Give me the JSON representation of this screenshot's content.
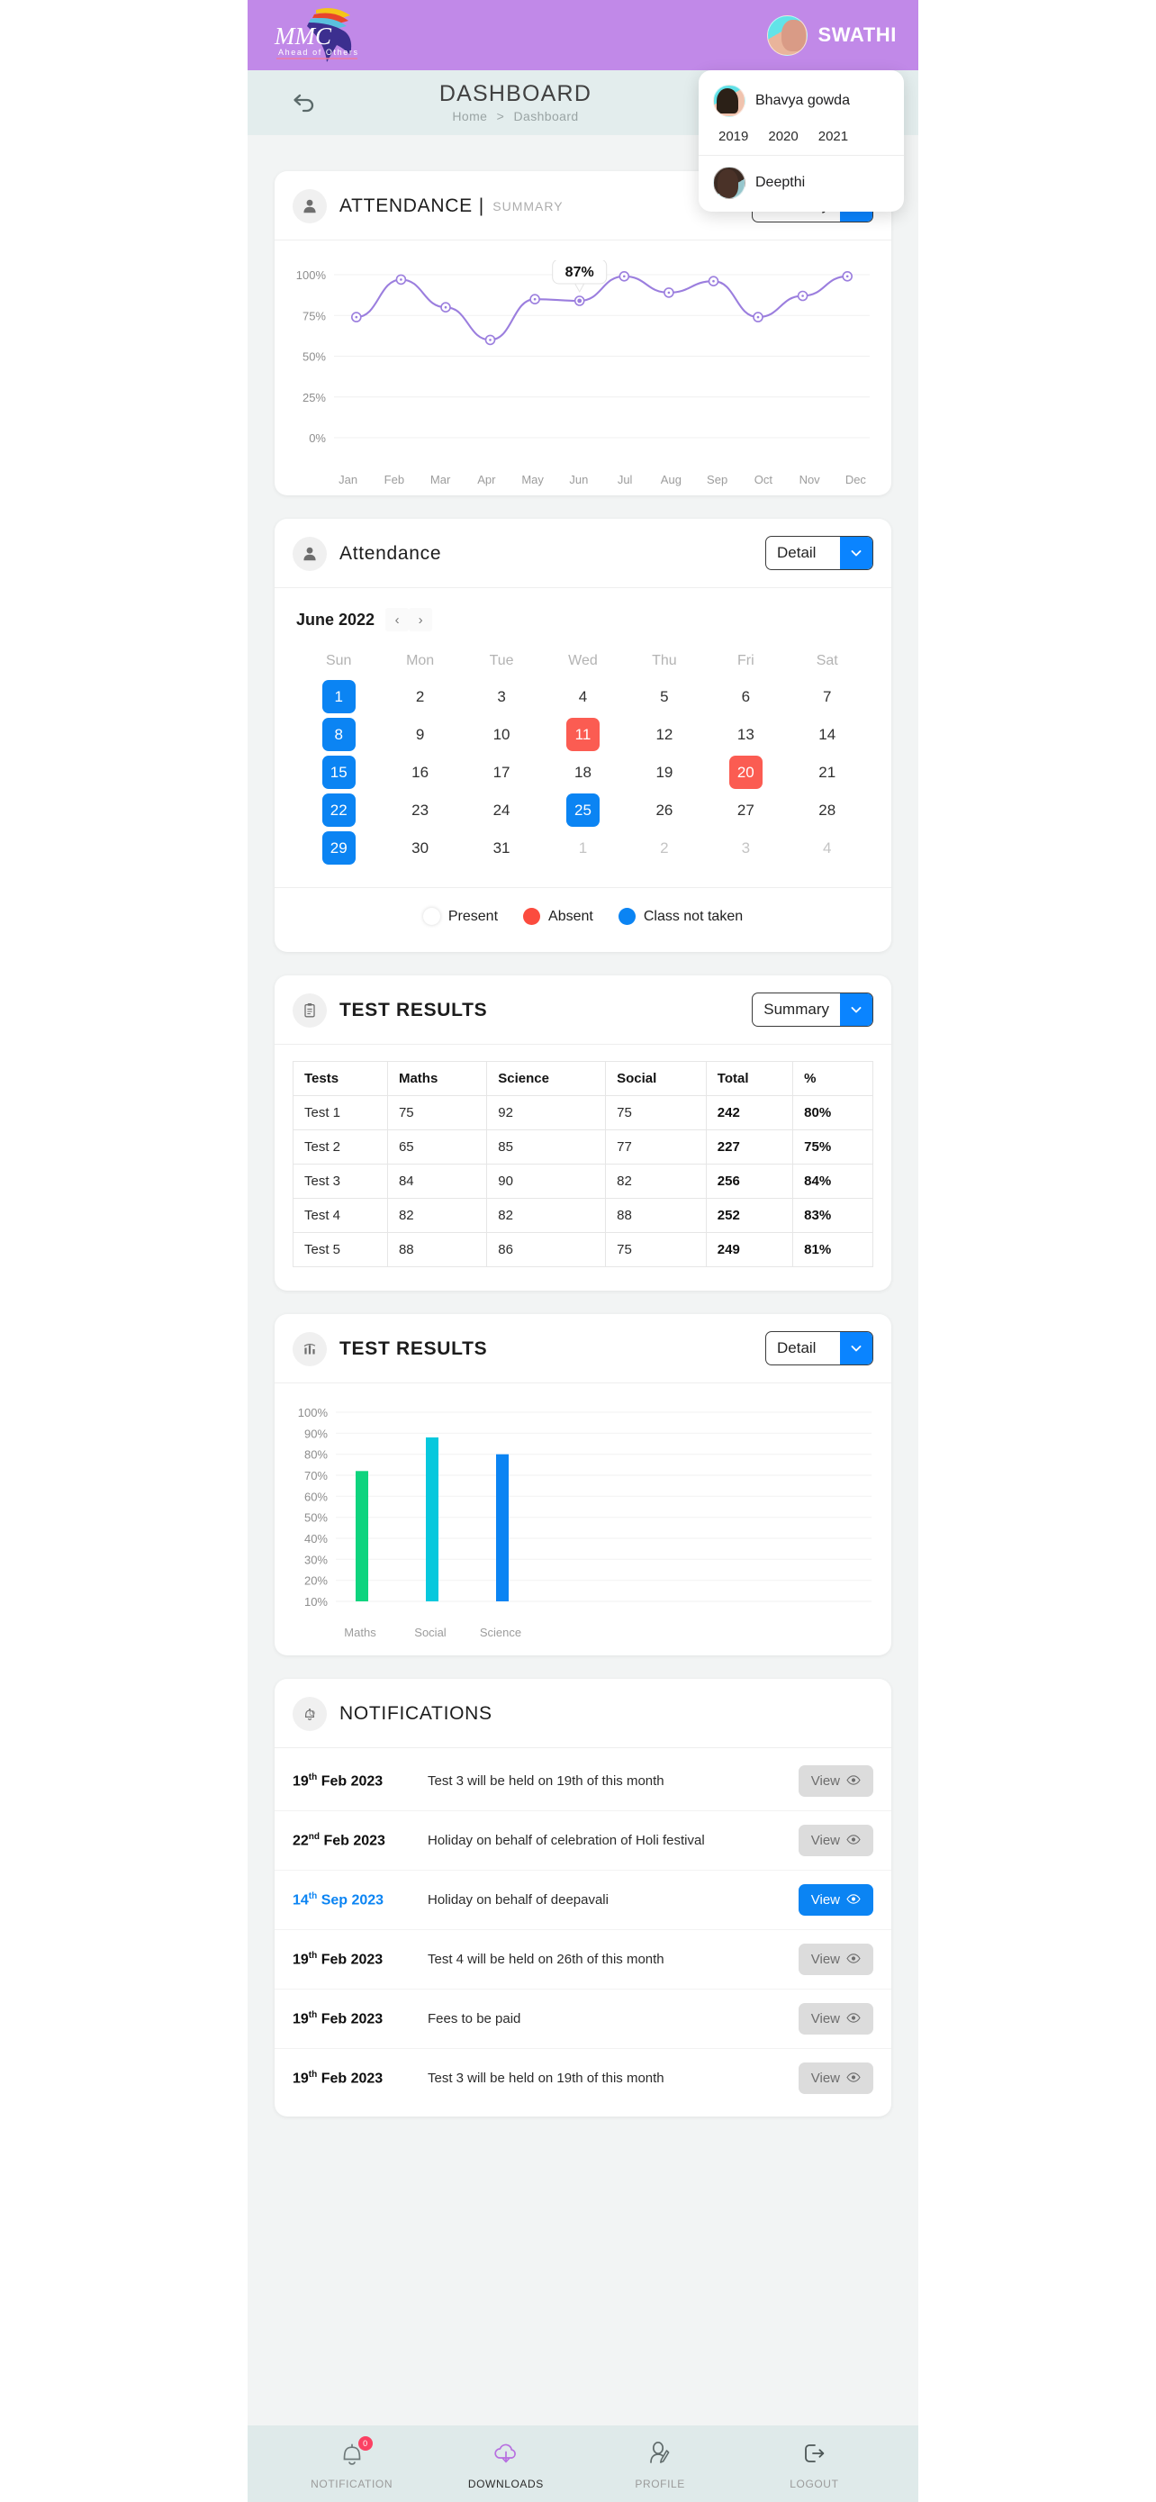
{
  "topbar": {
    "logo_text": "MMC",
    "logo_tagline": "Ahead of Others",
    "user_name": "SWATHI"
  },
  "user_dropdown": {
    "students": [
      {
        "name": "Bhavya gowda",
        "years": [
          "2019",
          "2020",
          "2021"
        ]
      },
      {
        "name": "Deepthi",
        "years": []
      }
    ]
  },
  "header": {
    "back_icon": "back-arrow-icon",
    "title": "DASHBOARD",
    "breadcrumb_home": "Home",
    "breadcrumb_sep": ">",
    "breadcrumb_current": "Dashboard"
  },
  "attendance_summary": {
    "icon": "person-icon",
    "title": "ATTENDANCE",
    "pipe": "|",
    "subtitle": "SUMMARY",
    "select_value": "Summary",
    "select_icon": "chevron-down-icon"
  },
  "attendance_detail": {
    "icon": "person-icon",
    "title": "Attendance",
    "select_value": "Detail",
    "select_icon": "chevron-down-icon",
    "month_label": "June 2022",
    "prev_icon": "chevron-left-icon",
    "next_icon": "chevron-right-icon",
    "dow": [
      "Sun",
      "Mon",
      "Tue",
      "Wed",
      "Thu",
      "Fri",
      "Sat"
    ],
    "weeks": [
      [
        {
          "d": "1",
          "s": "blue"
        },
        {
          "d": "2",
          "s": ""
        },
        {
          "d": "3",
          "s": ""
        },
        {
          "d": "4",
          "s": ""
        },
        {
          "d": "5",
          "s": ""
        },
        {
          "d": "6",
          "s": ""
        },
        {
          "d": "7",
          "s": ""
        }
      ],
      [
        {
          "d": "8",
          "s": "blue"
        },
        {
          "d": "9",
          "s": ""
        },
        {
          "d": "10",
          "s": ""
        },
        {
          "d": "11",
          "s": "red"
        },
        {
          "d": "12",
          "s": ""
        },
        {
          "d": "13",
          "s": ""
        },
        {
          "d": "14",
          "s": ""
        }
      ],
      [
        {
          "d": "15",
          "s": "blue"
        },
        {
          "d": "16",
          "s": ""
        },
        {
          "d": "17",
          "s": ""
        },
        {
          "d": "18",
          "s": ""
        },
        {
          "d": "19",
          "s": ""
        },
        {
          "d": "20",
          "s": "red"
        },
        {
          "d": "21",
          "s": ""
        }
      ],
      [
        {
          "d": "22",
          "s": "blue"
        },
        {
          "d": "23",
          "s": ""
        },
        {
          "d": "24",
          "s": ""
        },
        {
          "d": "25",
          "s": "blue"
        },
        {
          "d": "26",
          "s": ""
        },
        {
          "d": "27",
          "s": ""
        },
        {
          "d": "28",
          "s": ""
        }
      ],
      [
        {
          "d": "29",
          "s": "blue"
        },
        {
          "d": "30",
          "s": ""
        },
        {
          "d": "31",
          "s": ""
        },
        {
          "d": "1",
          "s": "muted"
        },
        {
          "d": "2",
          "s": "muted"
        },
        {
          "d": "3",
          "s": "muted"
        },
        {
          "d": "4",
          "s": "muted"
        }
      ]
    ],
    "legend": [
      {
        "label": "Present",
        "color": "#ffffff"
      },
      {
        "label": "Absent",
        "color": "#fb4b3e"
      },
      {
        "label": "Class not taken",
        "color": "#0b84f3"
      }
    ]
  },
  "test_results_table": {
    "icon": "clipboard-icon",
    "title": "TEST RESULTS",
    "select_value": "Summary",
    "select_icon": "chevron-down-icon",
    "columns": [
      "Tests",
      "Maths",
      "Science",
      "Social",
      "Total",
      "%"
    ],
    "rows": [
      [
        "Test 1",
        "75",
        "92",
        "75",
        "242",
        "80%"
      ],
      [
        "Test 2",
        "65",
        "85",
        "77",
        "227",
        "75%"
      ],
      [
        "Test 3",
        "84",
        "90",
        "82",
        "256",
        "84%"
      ],
      [
        "Test 4",
        "82",
        "82",
        "88",
        "252",
        "83%"
      ],
      [
        "Test 5",
        "88",
        "86",
        "75",
        "249",
        "81%"
      ]
    ]
  },
  "test_results_chart": {
    "icon": "bar-chart-icon",
    "title": "TEST RESULTS",
    "select_value": "Detail",
    "select_icon": "chevron-down-icon"
  },
  "notifications": {
    "icon": "bell-icon",
    "title": "NOTIFICATIONS",
    "view_label": "View",
    "view_icon": "eye-icon",
    "items": [
      {
        "day": "19",
        "ord": "th",
        "rest": "Feb 2023",
        "message": "Test 3 will be held on 19th of this month",
        "active": false
      },
      {
        "day": "22",
        "ord": "nd",
        "rest": "Feb 2023",
        "message": "Holiday on behalf of celebration of Holi festival",
        "active": false
      },
      {
        "day": "14",
        "ord": "th",
        "rest": "Sep 2023",
        "message": "Holiday on behalf of deepavali",
        "active": true
      },
      {
        "day": "19",
        "ord": "th",
        "rest": "Feb 2023",
        "message": "Test 4 will be held on 26th of this month",
        "active": false
      },
      {
        "day": "19",
        "ord": "th",
        "rest": "Feb 2023",
        "message": "Fees to be paid",
        "active": false
      },
      {
        "day": "19",
        "ord": "th",
        "rest": "Feb 2023",
        "message": "Test 3 will be held on 19th of this month",
        "active": false
      }
    ]
  },
  "bottom_nav": {
    "badge_count": "0",
    "items": [
      {
        "label": "NOTIFICATION",
        "icon": "bell-icon",
        "active": false
      },
      {
        "label": "DOWNLOADS",
        "icon": "download-cloud-icon",
        "active": true
      },
      {
        "label": "PROFILE",
        "icon": "profile-edit-icon",
        "active": false
      },
      {
        "label": "LOGOUT",
        "icon": "logout-icon",
        "active": false
      }
    ]
  },
  "chart_data": [
    {
      "type": "line",
      "title": "",
      "xlabel": "",
      "ylabel": "",
      "categories": [
        "Jan",
        "Feb",
        "Mar",
        "Apr",
        "May",
        "Jun",
        "Jul",
        "Aug",
        "Sep",
        "Oct",
        "Nov",
        "Dec"
      ],
      "values": [
        74,
        97,
        80,
        60,
        85,
        84,
        99,
        89,
        96,
        74,
        87,
        99
      ],
      "ylim": [
        0,
        100
      ],
      "yticks": [
        "0%",
        "25%",
        "50%",
        "75%",
        "100%"
      ],
      "annotation": {
        "label": "87%",
        "at_category": "Jun"
      },
      "series_color": "#9b7ede",
      "grid": true,
      "legend": "none"
    },
    {
      "type": "bar",
      "title": "",
      "xlabel": "",
      "ylabel": "",
      "categories": [
        "Maths",
        "Social",
        "Science"
      ],
      "values": [
        72,
        88,
        80
      ],
      "ylim": [
        10,
        100
      ],
      "yticks": [
        "10%",
        "20%",
        "30%",
        "40%",
        "50%",
        "60%",
        "70%",
        "80%",
        "90%",
        "100%"
      ],
      "colors": [
        "#0ed47e",
        "#07c8dd",
        "#0b84f3"
      ],
      "grid": true,
      "legend": "none"
    }
  ]
}
